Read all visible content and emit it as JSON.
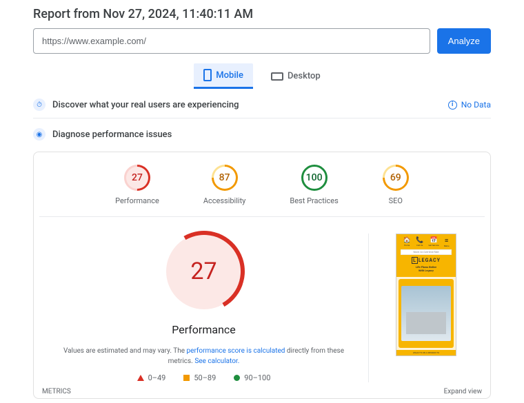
{
  "title": "Report from Nov 27, 2024, 11:40:11 AM",
  "url": "https://www.example.com/",
  "analyze": "Analyze",
  "tabs": {
    "mobile": "Mobile",
    "desktop": "Desktop"
  },
  "section_discover": "Discover what your real users are experiencing",
  "no_data": "No Data",
  "section_diagnose": "Diagnose performance issues",
  "scores": {
    "performance": {
      "value": "27",
      "label": "Performance"
    },
    "accessibility": {
      "value": "87",
      "label": "Accessibility"
    },
    "bestpractices": {
      "value": "100",
      "label": "Best Practices"
    },
    "seo": {
      "value": "69",
      "label": "SEO"
    }
  },
  "big": {
    "value": "27",
    "label": "Performance"
  },
  "desc": {
    "pre": "Values are estimated and may vary. The ",
    "link1": "performance score is calculated",
    "mid": " directly from these metrics. ",
    "link2": "See calculator."
  },
  "legend": {
    "r1": "0–49",
    "r2": "50–89",
    "r3": "90–100"
  },
  "mock": {
    "home": "Home",
    "call": "Call Us",
    "service": "Get Service",
    "menu": "Menu",
    "banner": "Never An Overtime Rate",
    "brand": "LEGACY",
    "l": "L",
    "tag": "Life Flows Better\nWith Legacy",
    "foot": "LEGACY'S ON A MISSION TO"
  },
  "footer": {
    "metrics": "METRICS",
    "expand": "Expand view"
  }
}
